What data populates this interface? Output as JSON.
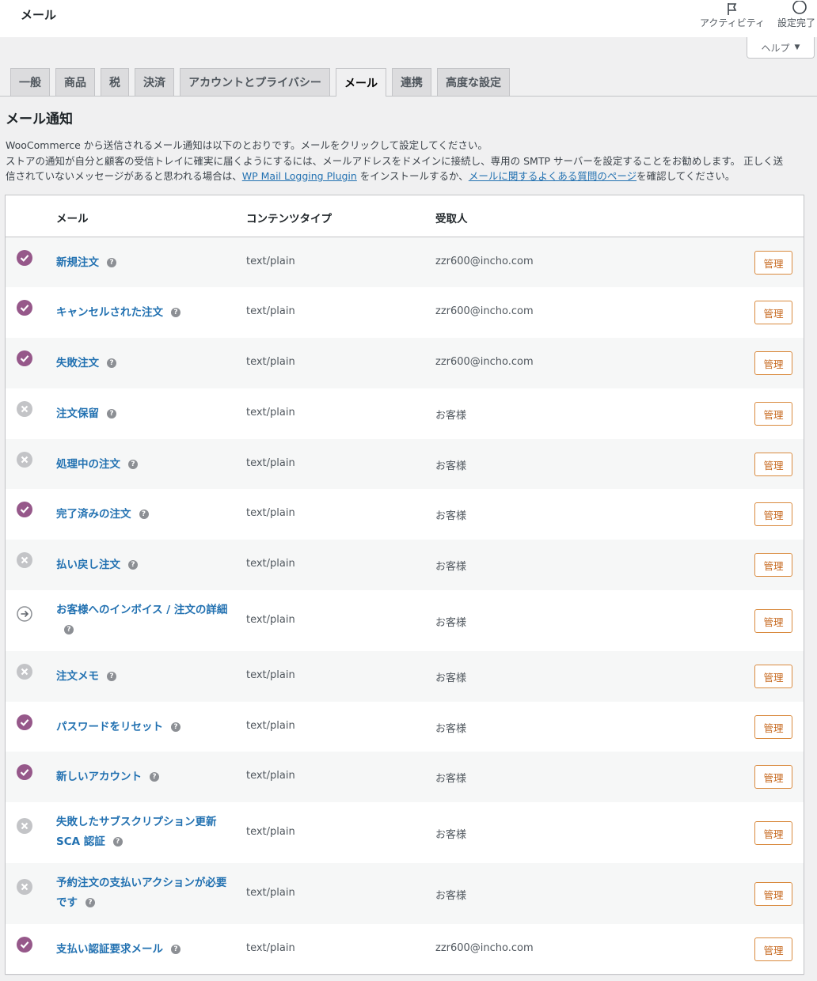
{
  "header": {
    "title": "メール",
    "activity_label": "アクティビティ",
    "setup_label": "設定完了",
    "help_label": "ヘルプ"
  },
  "tabs": [
    {
      "label": "一般"
    },
    {
      "label": "商品"
    },
    {
      "label": "税"
    },
    {
      "label": "決済"
    },
    {
      "label": "アカウントとプライバシー"
    },
    {
      "label": "メール",
      "active": true
    },
    {
      "label": "連携"
    },
    {
      "label": "高度な設定"
    }
  ],
  "section": {
    "title": "メール通知",
    "desc_line1": "WooCommerce から送信されるメール通知は以下のとおりです。メールをクリックして設定してください。",
    "desc_line2": "ストアの通知が自分と顧客の受信トレイに確実に届くようにするには、メールアドレスをドメインに接続し、専用の SMTP サーバーを設定することをお勧めします。 正しく送",
    "desc_line3_a": "信されていないメッセージがあると思われる場合は、",
    "desc_link1": "WP Mail Logging Plugin",
    "desc_line3_b": " をインストールするか、",
    "desc_link2": "メールに関するよくある質問のページ",
    "desc_line3_c": "を確認してください。"
  },
  "table": {
    "headers": {
      "email": "メール",
      "content_type": "コンテンツタイプ",
      "recipient": "受取人"
    },
    "manage_label": "管理",
    "help_glyph": "?",
    "status_colors": {
      "enabled": "#96588a",
      "disabled": "#c3c4c7",
      "manual": "#8c8f94"
    },
    "rows": [
      {
        "name": "新規注文",
        "status": "enabled",
        "content_type": "text/plain",
        "recipient": "zzr600@incho.com"
      },
      {
        "name": "キャンセルされた注文",
        "status": "enabled",
        "content_type": "text/plain",
        "recipient": "zzr600@incho.com"
      },
      {
        "name": "失敗注文",
        "status": "enabled",
        "content_type": "text/plain",
        "recipient": "zzr600@incho.com"
      },
      {
        "name": "注文保留",
        "status": "disabled",
        "content_type": "text/plain",
        "recipient": "お客様"
      },
      {
        "name": "処理中の注文",
        "status": "disabled",
        "content_type": "text/plain",
        "recipient": "お客様"
      },
      {
        "name": "完了済みの注文",
        "status": "enabled",
        "content_type": "text/plain",
        "recipient": "お客様"
      },
      {
        "name": "払い戻し注文",
        "status": "disabled",
        "content_type": "text/plain",
        "recipient": "お客様"
      },
      {
        "name": "お客様へのインボイス / 注文の詳細",
        "status": "manual",
        "content_type": "text/plain",
        "recipient": "お客様"
      },
      {
        "name": "注文メモ",
        "status": "disabled",
        "content_type": "text/plain",
        "recipient": "お客様"
      },
      {
        "name": "パスワードをリセット",
        "status": "enabled",
        "content_type": "text/plain",
        "recipient": "お客様"
      },
      {
        "name": "新しいアカウント",
        "status": "enabled",
        "content_type": "text/plain",
        "recipient": "お客様"
      },
      {
        "name": "失敗したサブスクリプション更新 SCA 認証",
        "status": "disabled",
        "content_type": "text/plain",
        "recipient": "お客様"
      },
      {
        "name": "予約注文の支払いアクションが必要です",
        "status": "disabled",
        "content_type": "text/plain",
        "recipient": "お客様"
      },
      {
        "name": "支払い認証要求メール",
        "status": "enabled",
        "content_type": "text/plain",
        "recipient": "zzr600@incho.com"
      }
    ]
  }
}
